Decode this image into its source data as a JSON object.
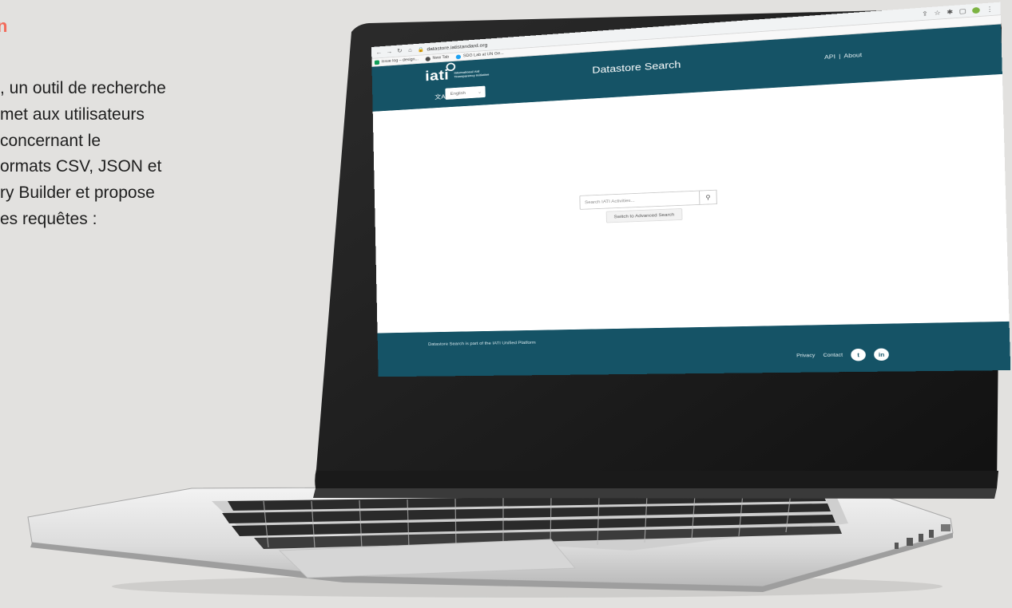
{
  "side_panel": {
    "heading": "n",
    "lines": [
      ", un outil de recherche",
      "met aux utilisateurs",
      "concernant le",
      "ormats CSV, JSON et",
      "ry Builder et propose",
      "es requêtes :"
    ]
  },
  "browser": {
    "url": "datastore.iatistandard.org",
    "bookmarks": [
      {
        "label": "issue log – design...",
        "color": "#0f9d58"
      },
      {
        "label": "New Tab",
        "color": "#4a4a4a"
      },
      {
        "label": "SDG Lab at UN Ge...",
        "color": "#1da1f2"
      }
    ],
    "icons": [
      "back-icon",
      "forward-icon",
      "reload-icon",
      "home-icon",
      "lock-icon",
      "share-icon",
      "star-icon",
      "extensions-icon",
      "window-icon",
      "profile-icon",
      "menu-icon"
    ]
  },
  "site": {
    "logo_text": "iati",
    "logo_tagline": "International Aid Transparency Initiative",
    "language": "English",
    "title": "Datastore Search",
    "links": [
      "API",
      "About"
    ],
    "search_placeholder": "Search IATI Activities...",
    "advanced_label": "Switch to Advanced Search",
    "footer_note": "Datastore Search is part of the IATI Unified Platform",
    "footer_links": [
      "Privacy",
      "Contact"
    ],
    "social": [
      {
        "name": "twitter",
        "glyph": "t"
      },
      {
        "name": "linkedin",
        "glyph": "in"
      }
    ],
    "colors": {
      "brand": "#155366",
      "accent_heading": "#f26b5b"
    }
  }
}
